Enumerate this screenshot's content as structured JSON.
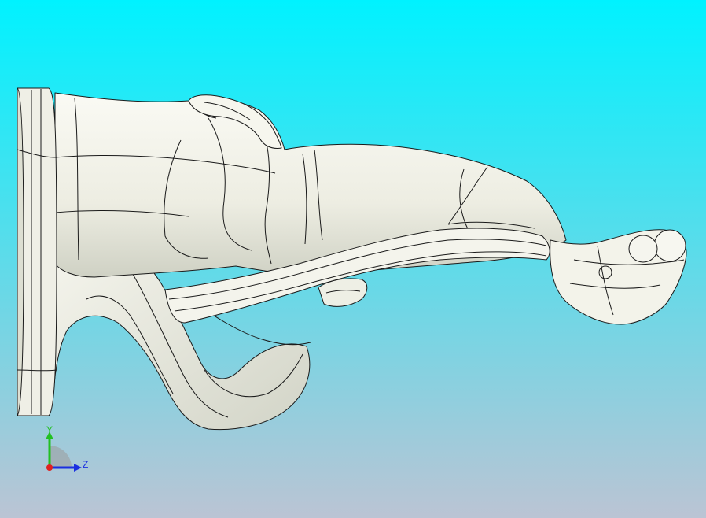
{
  "viewport": {
    "background_top": "#00F2FF",
    "background_bottom": "#BBC4D4",
    "model_fill": "#F3F3EA",
    "model_shade": "#C9CBBE",
    "edge_color": "#1A1A1A"
  },
  "triad": {
    "y_label": "Y",
    "z_label": "Z",
    "y_color": "#22C022",
    "z_color": "#1A2FE0",
    "x_color": "#E02020",
    "plane_color": "#9A9A9A"
  }
}
